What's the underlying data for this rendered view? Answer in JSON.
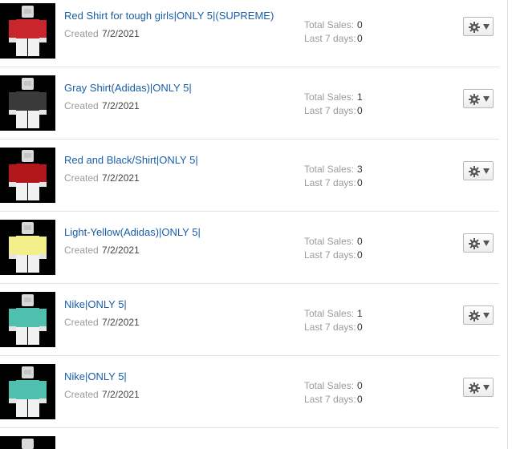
{
  "labels": {
    "created": "Created",
    "total_sales": "Total Sales:",
    "last7": "Last 7 days:"
  },
  "items": [
    {
      "title": "Red Shirt for tough girls|ONLY 5|(SUPREME)",
      "created": "7/2/2021",
      "total_sales": "0",
      "last7": "0",
      "shirt_color": "#c8262c"
    },
    {
      "title": "Gray Shirt(Adidas)|ONLY 5|",
      "created": "7/2/2021",
      "total_sales": "1",
      "last7": "0",
      "shirt_color": "#3a3a3a"
    },
    {
      "title": "Red and Black/Shirt|ONLY 5|",
      "created": "7/2/2021",
      "total_sales": "3",
      "last7": "0",
      "shirt_color": "#b3171c"
    },
    {
      "title": "Light-Yellow(Adidas)|ONLY 5|",
      "created": "7/2/2021",
      "total_sales": "0",
      "last7": "0",
      "shirt_color": "#f3f08c"
    },
    {
      "title": "Nike|ONLY 5|",
      "created": "7/2/2021",
      "total_sales": "1",
      "last7": "0",
      "shirt_color": "#4fbfae"
    },
    {
      "title": "Nike|ONLY 5|",
      "created": "7/2/2021",
      "total_sales": "0",
      "last7": "0",
      "shirt_color": "#4fbfae"
    }
  ],
  "gear_icon": "gear-icon"
}
